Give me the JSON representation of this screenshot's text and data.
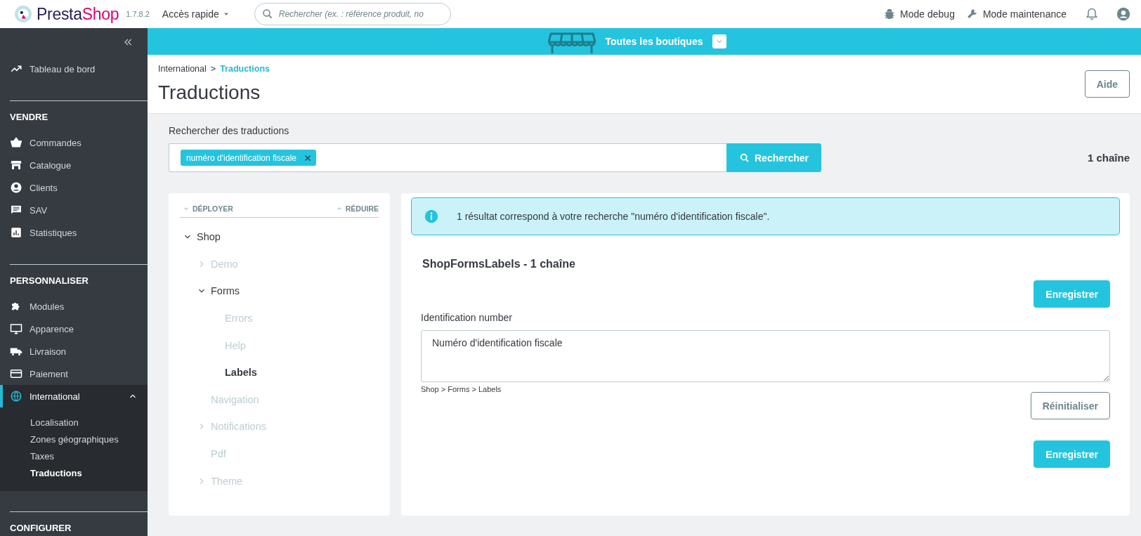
{
  "topbar": {
    "logo_parts": [
      "Presta",
      "Shop"
    ],
    "version": "1.7.8.2",
    "quick_access": "Accès rapide",
    "search": {
      "placeholder": "Rechercher (ex. : référence produit, no"
    },
    "actions": [
      "Mode debug",
      "Mode maintenance"
    ]
  },
  "sidebar": {
    "top_items": [
      {
        "label": "Tableau de bord",
        "selected": false
      }
    ],
    "sections": [
      {
        "title": "VENDRE",
        "items": [
          {
            "label": "Commandes",
            "selected": false,
            "expanded": false
          },
          {
            "label": "Catalogue",
            "selected": false,
            "expanded": false
          },
          {
            "label": "Clients",
            "selected": false,
            "expanded": false
          },
          {
            "label": "SAV",
            "selected": false,
            "expanded": false
          },
          {
            "label": "Statistiques",
            "selected": false,
            "expanded": false
          }
        ]
      },
      {
        "title": "PERSONNALISER",
        "items": [
          {
            "label": "Modules",
            "selected": false,
            "expanded": false
          },
          {
            "label": "Apparence",
            "selected": false,
            "expanded": false
          },
          {
            "label": "Livraison",
            "selected": false,
            "expanded": false
          },
          {
            "label": "Paiement",
            "selected": false,
            "expanded": false
          },
          {
            "label": "International",
            "selected": true,
            "expanded": true,
            "children": [
              {
                "label": "Localisation",
                "selected": false
              },
              {
                "label": "Zones géographiques",
                "selected": false
              },
              {
                "label": "Taxes",
                "selected": false
              },
              {
                "label": "Traductions",
                "selected": true
              }
            ]
          }
        ]
      },
      {
        "title": "CONFIGURER"
      }
    ]
  },
  "shop_bar": {
    "label": "Toutes les boutiques"
  },
  "breadcrumb": [
    {
      "label": "International",
      "current": false
    },
    {
      "separator": ">"
    },
    {
      "label": "Traductions",
      "current": true
    }
  ],
  "page_title": "Traductions",
  "help_button": "Aide",
  "search": {
    "label": "Rechercher des traductions",
    "tags": [
      "numéro d'identification fiscale"
    ],
    "button": "Rechercher",
    "count": "1 chaîne"
  },
  "tree": {
    "expand_all": "DÉPLOYER",
    "collapse_all": "RÉDUIRE",
    "nodes": [
      {
        "label": "Shop",
        "kind": "folder",
        "expanded": true,
        "dimmed": false,
        "selected": false,
        "children": [
          {
            "label": "Demo",
            "kind": "folder",
            "expanded": false,
            "dimmed": true,
            "selected": false
          },
          {
            "label": "Forms",
            "kind": "folder",
            "expanded": true,
            "dimmed": false,
            "selected": false,
            "children": [
              {
                "label": "Errors",
                "kind": "leaf",
                "dimmed": true,
                "selected": false
              },
              {
                "label": "Help",
                "kind": "leaf",
                "dimmed": true,
                "selected": false
              },
              {
                "label": "Labels",
                "kind": "leaf",
                "dimmed": false,
                "selected": true
              }
            ]
          },
          {
            "label": "Navigation",
            "kind": "leaf",
            "dimmed": true,
            "selected": false
          },
          {
            "label": "Notifications",
            "kind": "folder",
            "expanded": false,
            "dimmed": true,
            "selected": false
          },
          {
            "label": "Pdf",
            "kind": "leaf",
            "dimmed": true,
            "selected": false
          },
          {
            "label": "Theme",
            "kind": "folder",
            "expanded": false,
            "dimmed": true,
            "selected": false
          }
        ]
      }
    ]
  },
  "results": {
    "alert": "1 résultat correspond à votre recherche \"numéro d'identification fiscale\".",
    "domain_title": "ShopFormsLabels - 1 chaîne",
    "save_button": "Enregistrer",
    "entries": [
      {
        "label": "Identification number",
        "value": "Numéro d'identification fiscale",
        "path": "Shop > Forms > Labels",
        "reset_button": "Réinitialiser"
      }
    ],
    "save_button_bottom": "Enregistrer"
  }
}
